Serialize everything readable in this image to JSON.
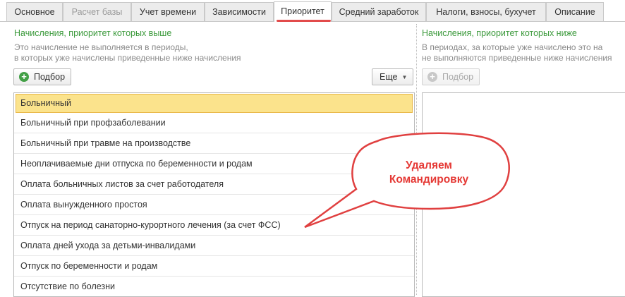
{
  "tabs": [
    {
      "label": "Основное",
      "state": "normal"
    },
    {
      "label": "Расчет базы",
      "state": "disabled"
    },
    {
      "label": "Учет времени",
      "state": "normal"
    },
    {
      "label": "Зависимости",
      "state": "normal"
    },
    {
      "label": "Приоритет",
      "state": "active"
    },
    {
      "label": "Средний заработок",
      "state": "normal"
    },
    {
      "label": "Налоги, взносы, бухучет",
      "state": "normal"
    },
    {
      "label": "Описание",
      "state": "normal"
    }
  ],
  "left_panel": {
    "title": "Начисления, приоритет которых выше",
    "hint_line1": "Это начисление не выполняется в периоды,",
    "hint_line2": "в которых уже начислены приведенные ниже начисления",
    "pick_button": "Подбор",
    "more_button": "Еще",
    "items": [
      "Больничный",
      "Больничный при профзаболевании",
      "Больничный при травме на производстве",
      "Неоплачиваемые дни отпуска по беременности и родам",
      "Оплата больничных листов за счет работодателя",
      "Оплата вынужденного простоя",
      "Отпуск на период санаторно-курортного лечения (за счет ФСС)",
      "Оплата дней ухода за детьми-инвалидами",
      "Отпуск по беременности и родам",
      "Отсутствие по болезни"
    ],
    "selected_index": 0
  },
  "right_panel": {
    "title": "Начисления, приоритет которых ниже",
    "hint_line1": "В периодах, за которые уже начислено это на",
    "hint_line2": "не выполняются приведенные ниже начисления",
    "pick_button": "Подбор"
  },
  "callout": {
    "line1": "Удаляем",
    "line2": "Командировку"
  },
  "colors": {
    "accent_green": "#3c9a3c",
    "selection": "#fbe38c",
    "callout_red": "#e53935",
    "tab_underline": "#e24b4b"
  }
}
